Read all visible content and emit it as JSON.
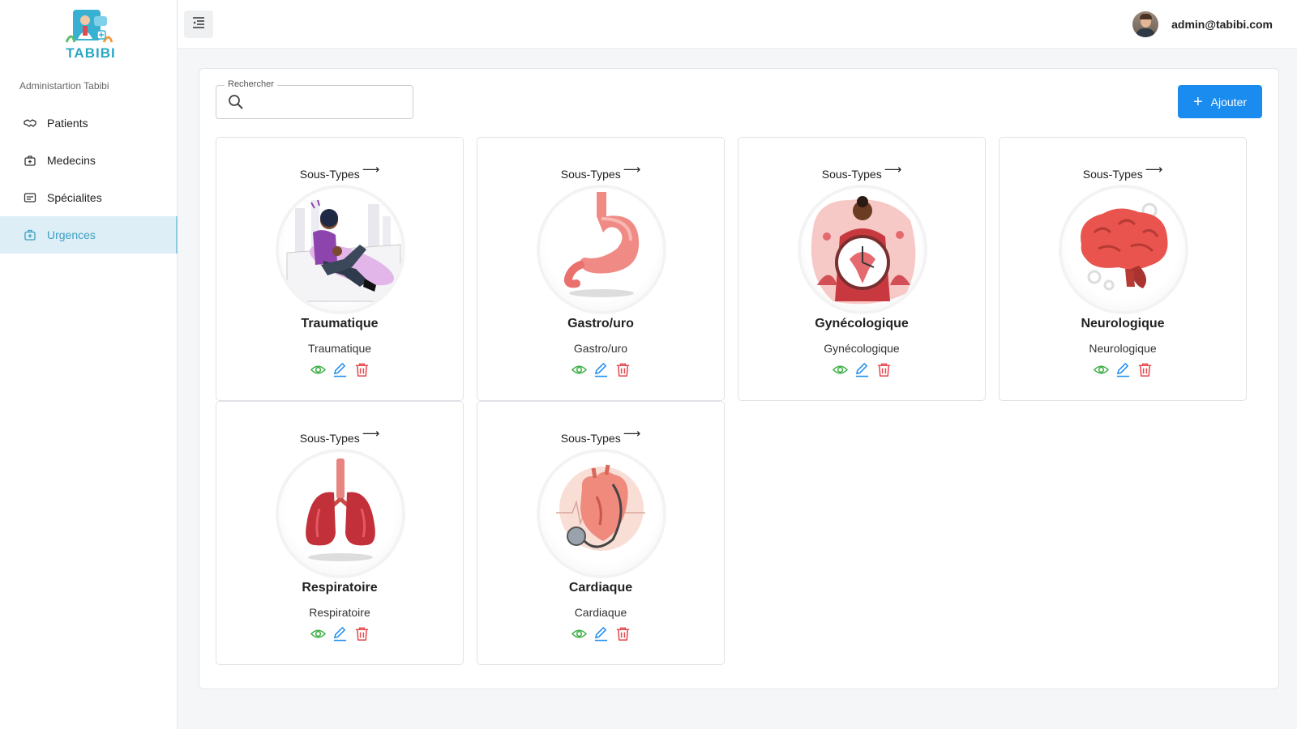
{
  "sidebar": {
    "logo_text": "TABIBI",
    "admin_label": "Administartion Tabibi",
    "items": [
      {
        "label": "Patients",
        "icon": "handshake-icon"
      },
      {
        "label": "Medecins",
        "icon": "medical-bag-icon"
      },
      {
        "label": "Spécialites",
        "icon": "list-icon"
      },
      {
        "label": "Urgences",
        "icon": "first-aid-icon",
        "active": true
      }
    ]
  },
  "topbar": {
    "menu_icon": "menu-collapse-icon",
    "user_email": "admin@tabibi.com"
  },
  "toolbar": {
    "search_label": "Rechercher",
    "search_value": "",
    "add_label": "Ajouter"
  },
  "cards": [
    {
      "link": "Sous-Types",
      "title": "Traumatique",
      "subtitle": "Traumatique",
      "image": "injured-person-illustration"
    },
    {
      "link": "Sous-Types",
      "title": "Gastro/uro",
      "subtitle": "Gastro/uro",
      "image": "stomach-illustration"
    },
    {
      "link": "Sous-Types",
      "title": "Gynécologique",
      "subtitle": "Gynécologique",
      "image": "woman-uterus-clock-illustration"
    },
    {
      "link": "Sous-Types",
      "title": "Neurologique",
      "subtitle": "Neurologique",
      "image": "brain-illustration"
    },
    {
      "link": "Sous-Types",
      "title": "Respiratoire",
      "subtitle": "Respiratoire",
      "image": "lungs-illustration"
    },
    {
      "link": "Sous-Types",
      "title": "Cardiaque",
      "subtitle": "Cardiaque",
      "image": "heart-stethoscope-illustration"
    }
  ],
  "colors": {
    "accent": "#1a8cf0",
    "active_nav_bg": "#ddeef6",
    "active_nav_text": "#3d9fc2",
    "view_icon": "#3cb043",
    "edit_icon": "#1a8cf0",
    "delete_icon": "#e5484d"
  }
}
